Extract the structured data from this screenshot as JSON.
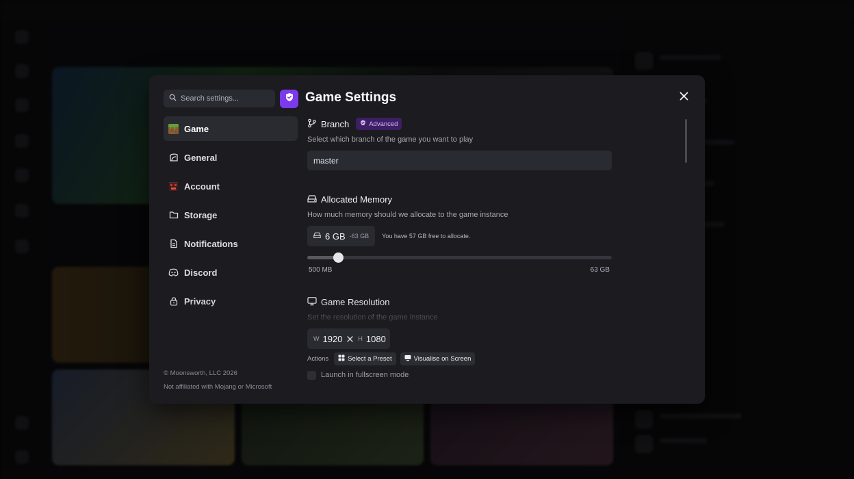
{
  "colors": {
    "accent": "#7c3aed",
    "badge_bg": "#3d1f63",
    "badge_text": "#d6bbfb",
    "modal_bg": "#1b1b20",
    "input_bg": "#2a2a31"
  },
  "search": {
    "placeholder": "Search settings...",
    "icon": "search-icon"
  },
  "modal": {
    "title": "Game Settings",
    "close_icon": "close-icon"
  },
  "sidebar": {
    "items": [
      {
        "label": "Game",
        "icon": "grass-block-icon",
        "active": true
      },
      {
        "label": "General",
        "icon": "general-icon",
        "active": false
      },
      {
        "label": "Account",
        "icon": "account-icon",
        "active": false
      },
      {
        "label": "Storage",
        "icon": "folder-icon",
        "active": false
      },
      {
        "label": "Notifications",
        "icon": "notification-icon",
        "active": false
      },
      {
        "label": "Discord",
        "icon": "discord-icon",
        "active": false
      },
      {
        "label": "Privacy",
        "icon": "lock-icon",
        "active": false
      }
    ],
    "footer_copyright": "© Moonsworth, LLC 2026",
    "footer_disclaimer": "Not affiliated with Mojang or Microsoft"
  },
  "branch": {
    "heading": "Branch",
    "badge": "Advanced",
    "description": "Select which branch of the game you want to play",
    "value": "master"
  },
  "memory": {
    "heading": "Allocated Memory",
    "description": "How much memory should we allocate to the game instance",
    "value": "6 GB",
    "diff": "-63 GB",
    "note": "You have 57 GB free to allocate.",
    "slider_min_label": "500 MB",
    "slider_max_label": "63 GB",
    "slider_fraction": 0.1
  },
  "resolution": {
    "heading": "Game Resolution",
    "description": "Set the resolution of the game instance",
    "width_prefix": "W",
    "width": "1920",
    "height_prefix": "H",
    "height": "1080",
    "actions_label": "Actions",
    "preset_button": "Select a Preset",
    "visualise_button": "Visualise on Screen",
    "fullscreen_label": "Launch in fullscreen mode"
  }
}
